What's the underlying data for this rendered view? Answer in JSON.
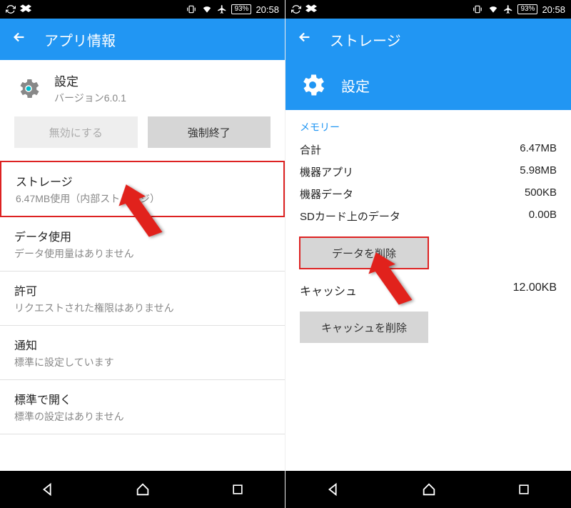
{
  "status": {
    "battery": "93%",
    "time": "20:58"
  },
  "left": {
    "appbar_title": "アプリ情報",
    "app_name": "設定",
    "app_version": "バージョン6.0.1",
    "disable_btn": "無効にする",
    "force_stop_btn": "強制終了",
    "storage": {
      "title": "ストレージ",
      "sub": "6.47MB使用（内部ストレージ）"
    },
    "data_usage": {
      "title": "データ使用",
      "sub": "データ使用量はありません"
    },
    "permissions": {
      "title": "許可",
      "sub": "リクエストされた権限はありません"
    },
    "notifications": {
      "title": "通知",
      "sub": "標準に設定しています"
    },
    "open_default": {
      "title": "標準で開く",
      "sub": "標準の設定はありません"
    }
  },
  "right": {
    "appbar_title": "ストレージ",
    "app_name": "設定",
    "memory_label": "メモリー",
    "rows": {
      "total": {
        "label": "合計",
        "val": "6.47MB"
      },
      "app": {
        "label": "機器アプリ",
        "val": "5.98MB"
      },
      "data": {
        "label": "機器データ",
        "val": "500KB"
      },
      "sd": {
        "label": "SDカード上のデータ",
        "val": "0.00B"
      }
    },
    "clear_data_btn": "データを削除",
    "cache_label": "キャッシュ",
    "cache_val": "12.00KB",
    "clear_cache_btn": "キャッシュを削除"
  }
}
